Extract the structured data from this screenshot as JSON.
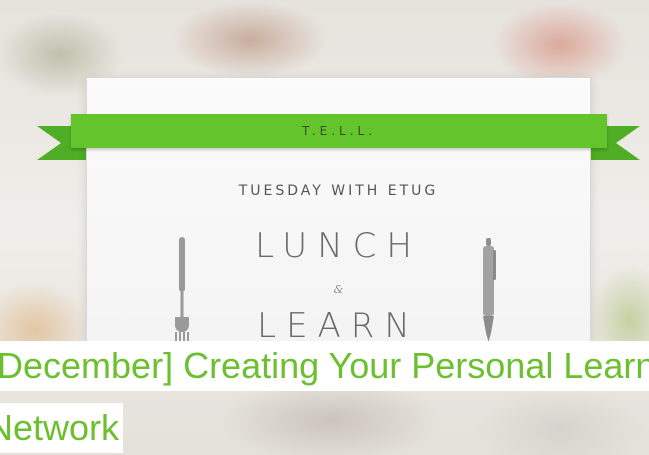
{
  "hero": {
    "ribbon_text": "T.E.L.L.",
    "subtitle": "TUESDAY WITH ETUG",
    "word1": "LUNCH",
    "ampersand": "&",
    "word2": "LEARN"
  },
  "post": {
    "title_line1": "[December] Creating Your Personal Learning",
    "title_line2": "Network"
  },
  "colors": {
    "ribbon": "#63c42b",
    "title_text": "#6cbf2e"
  },
  "icons": {
    "fork": "fork-icon",
    "pen": "pen-icon"
  }
}
